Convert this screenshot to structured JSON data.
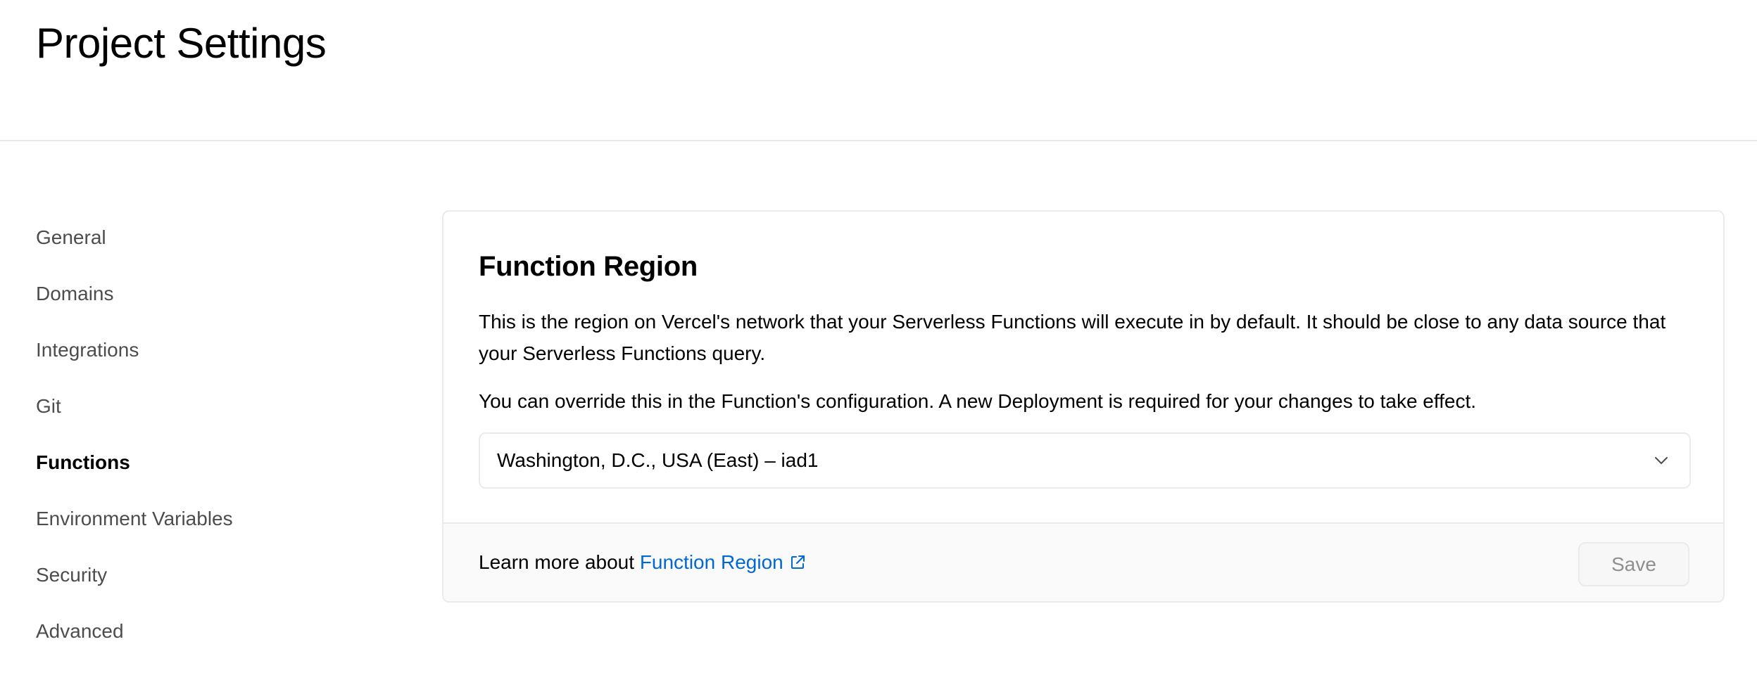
{
  "header": {
    "title": "Project Settings"
  },
  "sidebar": {
    "items": [
      {
        "label": "General",
        "active": false
      },
      {
        "label": "Domains",
        "active": false
      },
      {
        "label": "Integrations",
        "active": false
      },
      {
        "label": "Git",
        "active": false
      },
      {
        "label": "Functions",
        "active": true
      },
      {
        "label": "Environment Variables",
        "active": false
      },
      {
        "label": "Security",
        "active": false
      },
      {
        "label": "Advanced",
        "active": false
      }
    ]
  },
  "card": {
    "title": "Function Region",
    "description": "This is the region on Vercel's network that your Serverless Functions will execute in by default. It should be close to any data source that your Serverless Functions query.",
    "note": "You can override this in the Function's configuration. A new Deployment is required for your changes to take effect.",
    "region_select": {
      "value": "Washington, D.C., USA (East) – iad1",
      "icon": "chevron-down-icon"
    },
    "footer": {
      "learn_prefix": "Learn more about ",
      "learn_link": "Function Region",
      "link_icon": "external-link-icon",
      "save_label": "Save",
      "save_disabled": true
    }
  },
  "colors": {
    "link": "#0068d6",
    "border": "#ebebeb",
    "footer_bg": "#fafafa",
    "muted_text": "#4d4d4d",
    "disabled_text": "#8f8f8f"
  }
}
